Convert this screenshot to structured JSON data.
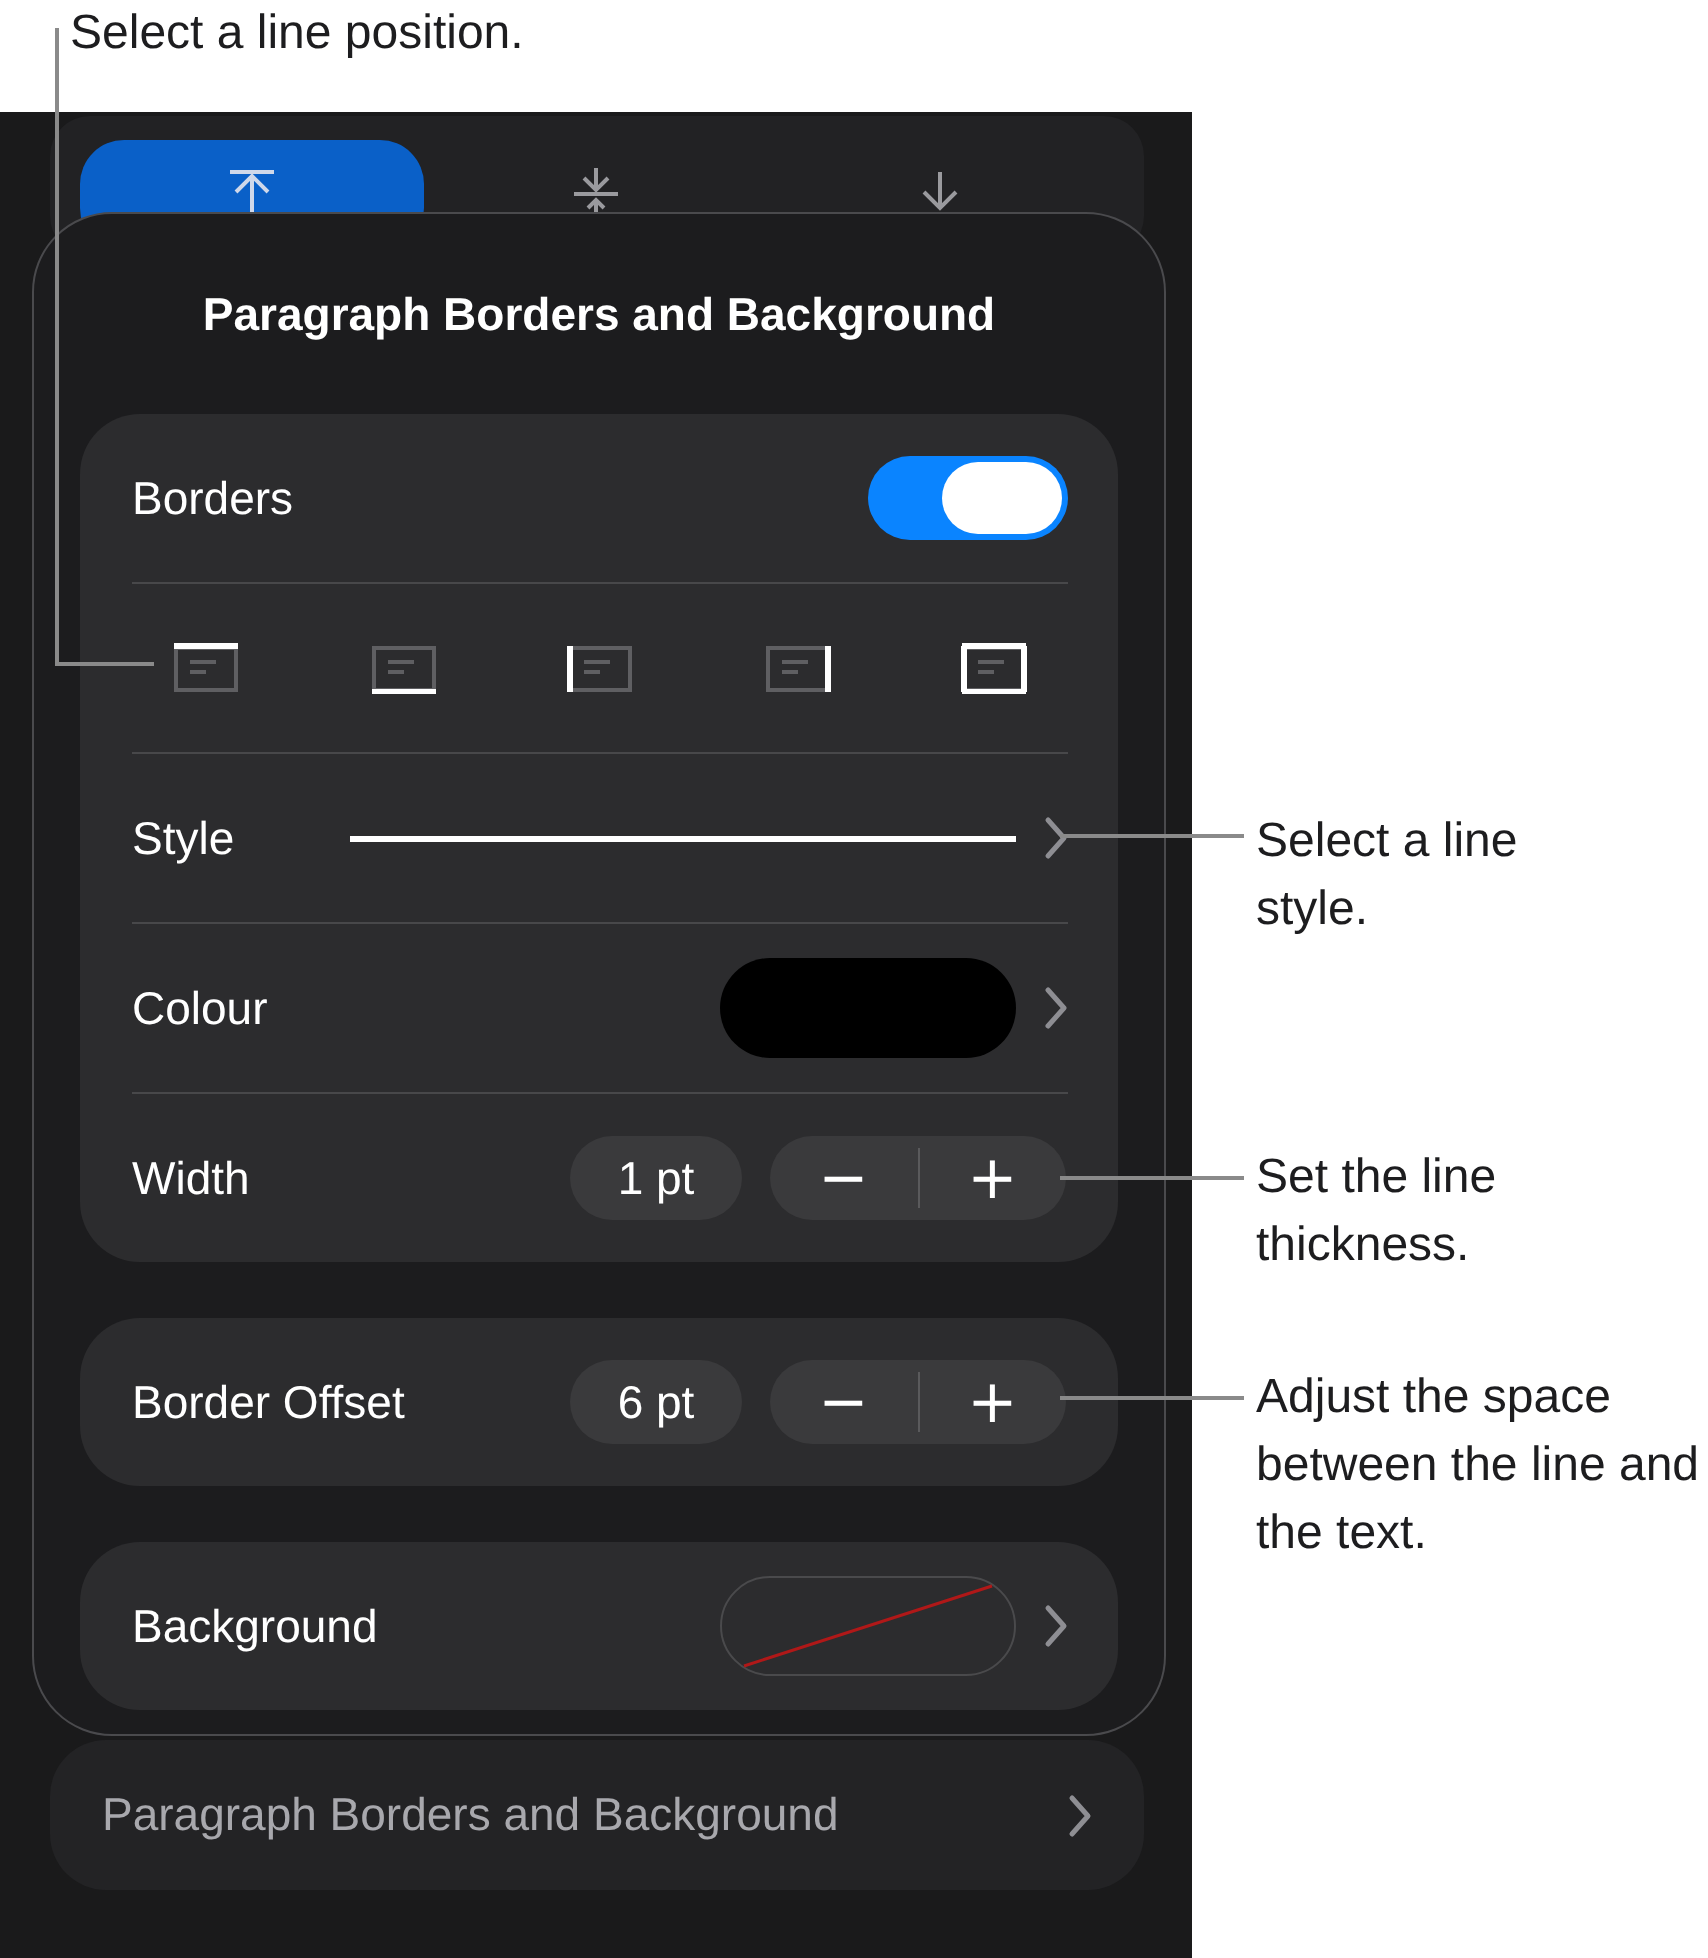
{
  "callouts": [
    {
      "text": "Select a line position."
    },
    {
      "text": "Select a line style."
    },
    {
      "text": "Set the line thickness."
    },
    {
      "text": "Adjust the space between the line and the text."
    }
  ],
  "segments": [
    {
      "kind": "top",
      "selected": true
    },
    {
      "kind": "middle",
      "selected": false
    },
    {
      "kind": "bottom",
      "selected": false
    }
  ],
  "popover": {
    "title": "Paragraph Borders and Background",
    "borders": {
      "label": "Borders",
      "on": true
    },
    "positions": [
      {
        "kind": "top"
      },
      {
        "kind": "bottom"
      },
      {
        "kind": "left"
      },
      {
        "kind": "right"
      },
      {
        "kind": "all"
      }
    ],
    "style": {
      "label": "Style"
    },
    "colour": {
      "label": "Colour",
      "color": "#000000"
    },
    "width": {
      "label": "Width",
      "value": "1 pt",
      "minus": "−",
      "plus": "+"
    },
    "offset": {
      "label": "Border Offset",
      "value": "6 pt",
      "minus": "−",
      "plus": "+"
    },
    "background": {
      "label": "Background"
    }
  },
  "bottom_row": {
    "label": "Paragraph Borders and Background"
  }
}
